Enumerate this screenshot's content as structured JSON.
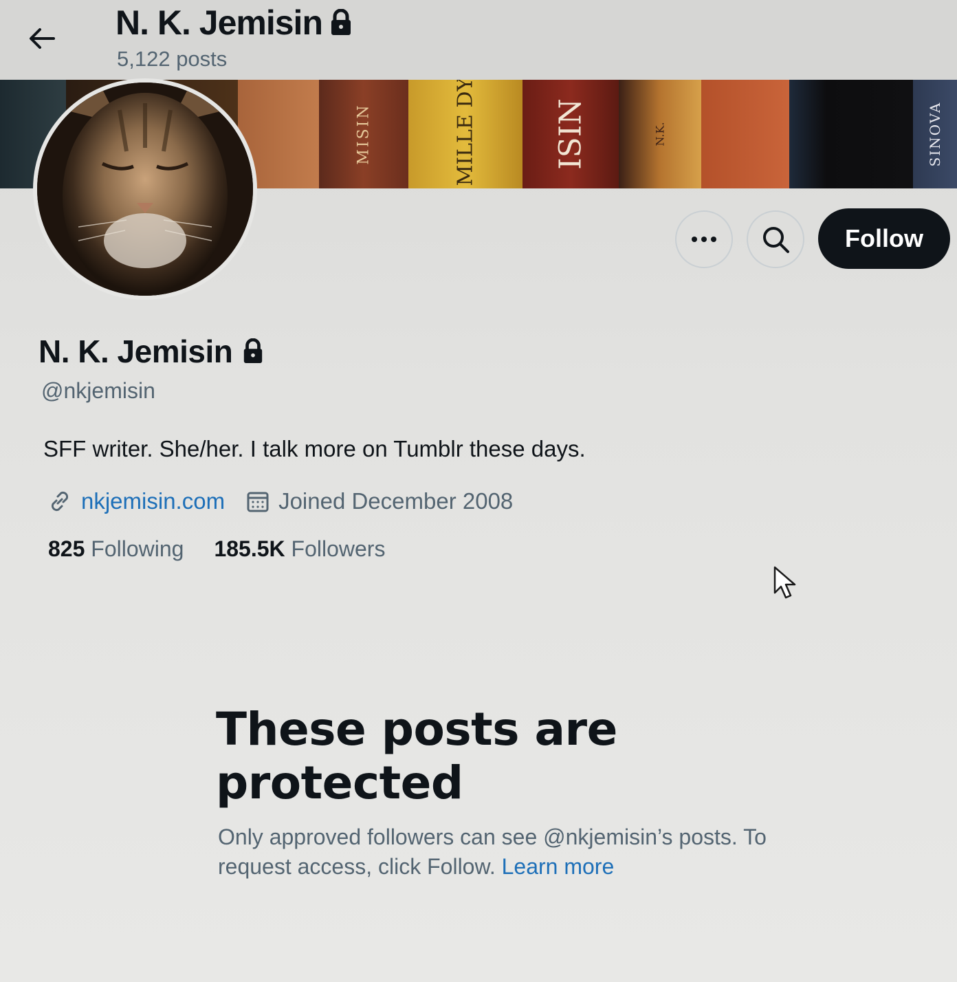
{
  "header": {
    "title": "N. K. Jemisin",
    "posts_count": "5,122 posts",
    "back_icon": "arrow-left-icon",
    "lock_icon": "lock-icon"
  },
  "banner": {
    "spines": [
      "",
      "",
      "MISIN",
      "ENT MILLE DYAUN",
      "ISIN",
      "N.K.",
      "",
      "",
      "SINOVA"
    ]
  },
  "actions": {
    "more_icon": "ellipsis-icon",
    "search_icon": "search-icon",
    "follow_label": "Follow"
  },
  "profile": {
    "name": "N. K. Jemisin",
    "handle": "@nkjemisin",
    "bio": "SFF writer. She/her. I talk more on Tumblr these days.",
    "website": "nkjemisin.com",
    "joined": "Joined December 2008",
    "following_count": "825",
    "following_label": "Following",
    "followers_count": "185.5K",
    "followers_label": "Followers"
  },
  "protected": {
    "title": "These posts are protected",
    "description": "Only approved followers can see @nkjemisin’s posts. To request access, click Follow.",
    "learn_more": "Learn more"
  },
  "colors": {
    "accent_link": "#1d6fb8",
    "follow_bg": "#0f1419",
    "secondary_text": "#536471"
  }
}
